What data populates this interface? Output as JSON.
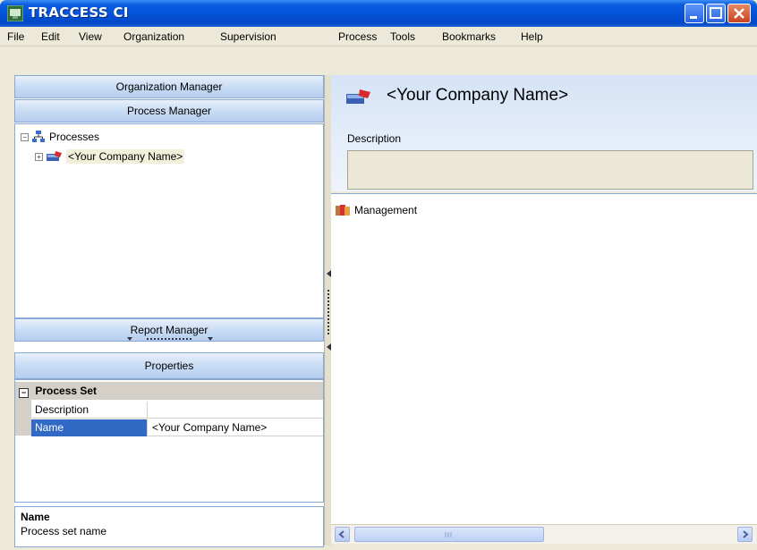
{
  "window": {
    "title": "TRACCESS CI"
  },
  "menu": [
    "File",
    "Edit",
    "View",
    "Organization",
    "Supervision",
    "Process",
    "Tools",
    "Bookmarks",
    "Help"
  ],
  "left": {
    "organization_manager": "Organization Manager",
    "process_manager": "Process Manager",
    "report_manager": "Report Manager",
    "properties": "Properties",
    "tree": {
      "root": {
        "label": "Processes",
        "expanded": true
      },
      "child": {
        "label": "<Your Company Name>",
        "expanded": false,
        "selected": true
      }
    },
    "property_grid": {
      "group": "Process Set",
      "rows": [
        {
          "name": "Description",
          "value": ""
        },
        {
          "name": "Name",
          "value": "<Your Company Name>",
          "selected": true
        }
      ]
    },
    "help": {
      "title": "Name",
      "description": "Process set name"
    }
  },
  "right": {
    "title": "<Your Company Name>",
    "description_label": "Description",
    "description_value": "",
    "items": [
      {
        "label": "Management",
        "icon": "folder-group-icon"
      }
    ]
  },
  "colors": {
    "titlebar": "#0453d8",
    "selection": "#316ac5",
    "accent_header": "#c9dcf4"
  }
}
